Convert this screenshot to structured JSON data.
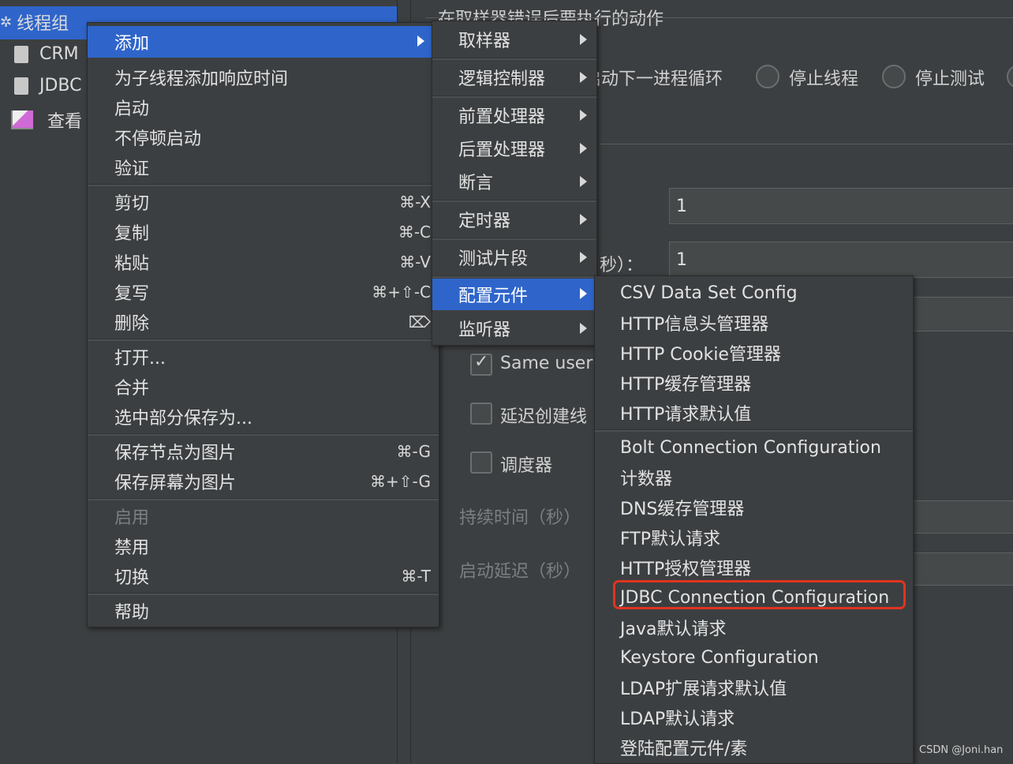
{
  "tree": {
    "root": "线程组",
    "items": [
      "CRM",
      "JDBC",
      "查看"
    ]
  },
  "right_panel": {
    "group_title": "在取样器错误后要执行的动作",
    "radio_labels": [
      "启动下一进程循环",
      "停止线程",
      "停止测试"
    ],
    "field1_value": "1",
    "field2_label_fragment": "秒）：",
    "field2_value": "1",
    "same_user": "Same user",
    "delay_create": "延迟创建线",
    "scheduler": "调度器",
    "duration": "持续时间（秒）",
    "startup_delay": "启动延迟（秒）"
  },
  "context_menu": {
    "items": [
      {
        "label": "添加",
        "submenu": true
      },
      {
        "label": "为子线程添加响应时间"
      },
      {
        "label": "启动"
      },
      {
        "label": "不停顿启动"
      },
      {
        "label": "验证"
      },
      {
        "label": "剪切",
        "shortcut": "⌘-X"
      },
      {
        "label": "复制",
        "shortcut": "⌘-C"
      },
      {
        "label": "粘贴",
        "shortcut": "⌘-V"
      },
      {
        "label": "复写",
        "shortcut": "⌘+⇧-C"
      },
      {
        "label": "删除",
        "shortcut": "⌦"
      },
      {
        "label": "打开..."
      },
      {
        "label": "合并"
      },
      {
        "label": "选中部分保存为..."
      },
      {
        "label": "保存节点为图片",
        "shortcut": "⌘-G"
      },
      {
        "label": "保存屏幕为图片",
        "shortcut": "⌘+⇧-G"
      },
      {
        "label": "启用",
        "disabled": true
      },
      {
        "label": "禁用"
      },
      {
        "label": "切换",
        "shortcut": "⌘-T"
      },
      {
        "label": "帮助"
      }
    ]
  },
  "add_submenu": {
    "items": [
      "取样器",
      "逻辑控制器",
      "前置处理器",
      "后置处理器",
      "断言",
      "定时器",
      "测试片段",
      "配置元件",
      "监听器"
    ]
  },
  "config_submenu": {
    "items": [
      "CSV Data Set Config",
      "HTTP信息头管理器",
      "HTTP Cookie管理器",
      "HTTP缓存管理器",
      "HTTP请求默认值",
      "Bolt Connection Configuration",
      "计数器",
      "DNS缓存管理器",
      "FTP默认请求",
      "HTTP授权管理器",
      "JDBC Connection Configuration",
      "Java默认请求",
      "Keystore Configuration",
      "LDAP扩展请求默认值",
      "LDAP默认请求",
      "登陆配置元件/素"
    ]
  },
  "watermark": "CSDN @Joni.han",
  "colors": {
    "selection": "#2f65ca",
    "highlight": "#e0341f",
    "background": "#3c3f41"
  }
}
